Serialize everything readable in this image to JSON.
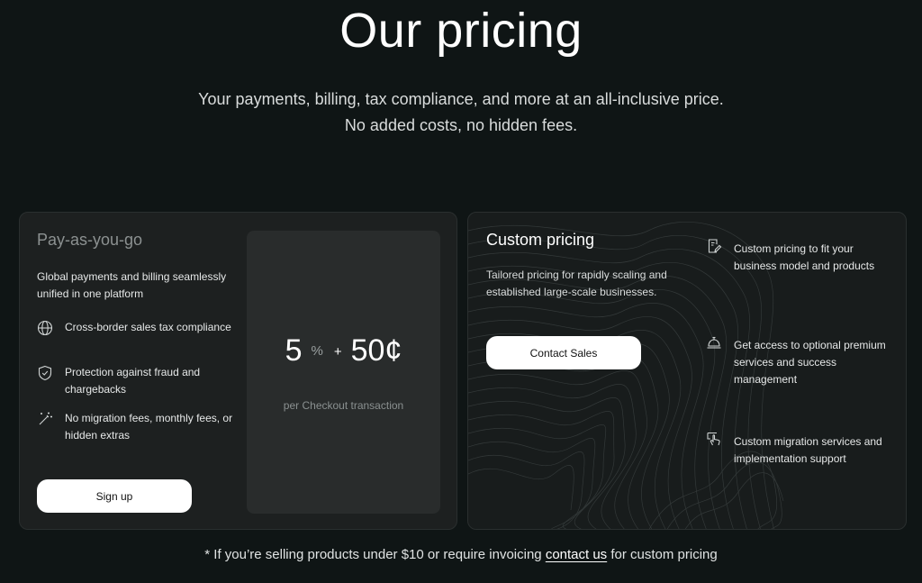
{
  "header": {
    "title": "Our pricing",
    "subtitle_line1": "Your payments, billing, tax compliance, and more at an all-inclusive price.",
    "subtitle_line2": "No added costs, no hidden fees."
  },
  "payg": {
    "name": "Pay-as-you-go",
    "description": "Global payments and billing seamlessly unified in one platform",
    "features": [
      {
        "icon": "globe-icon",
        "text": "Cross-border sales tax compliance"
      },
      {
        "icon": "shield-icon",
        "text": "Protection against fraud and chargebacks"
      },
      {
        "icon": "magic-wand-icon",
        "text": "No migration fees, monthly fees, or hidden extras"
      }
    ],
    "button_label": "Sign up",
    "price": {
      "percent_value": "5",
      "percent_symbol": "%",
      "plus": "+",
      "fixed": "50¢",
      "note": "per Checkout transaction"
    }
  },
  "custom": {
    "name": "Custom pricing",
    "description": "Tailored pricing for rapidly scaling and established large-scale businesses.",
    "button_label": "Contact Sales",
    "features": [
      {
        "icon": "document-edit-icon",
        "text": "Custom pricing to fit your business model and products"
      },
      {
        "icon": "service-bell-icon",
        "text": "Get access to optional premium services and success management"
      },
      {
        "icon": "hand-pointer-icon",
        "text": "Custom migration services and implementation support"
      }
    ]
  },
  "footnote": {
    "prefix": "* If you’re selling products under $10 or require invoicing ",
    "link": "contact us",
    "suffix": " for custom pricing"
  },
  "colors": {
    "background": "#0f1515",
    "card": "#1d2020",
    "price_panel": "#292c2c",
    "button": "#ffffff"
  }
}
